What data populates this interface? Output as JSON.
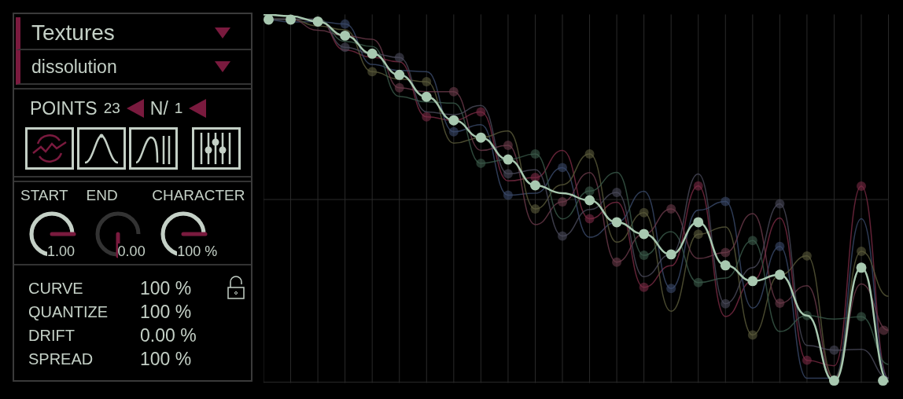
{
  "preset": {
    "category": "Textures",
    "name": "dissolution"
  },
  "points": {
    "label": "POINTS",
    "count": "23",
    "n_label": "N/",
    "n_value": "1"
  },
  "modes": [
    {
      "kind": "random",
      "selected": true
    },
    {
      "kind": "bell",
      "selected": false
    },
    {
      "kind": "rise",
      "selected": false
    },
    {
      "kind": "mixer",
      "selected": false
    }
  ],
  "knobs": [
    {
      "label": "START",
      "reading": "1.00"
    },
    {
      "label": "END",
      "reading": "0.00"
    },
    {
      "label": "CHARACTER",
      "reading": "100 %"
    }
  ],
  "params": [
    {
      "label": "CURVE",
      "value": "100 %"
    },
    {
      "label": "QUANTIZE",
      "value": "100 %"
    },
    {
      "label": "DRIFT",
      "value": "0.00 %"
    },
    {
      "label": "SPREAD",
      "value": "100 %"
    }
  ],
  "lock": {
    "locked": false
  }
}
